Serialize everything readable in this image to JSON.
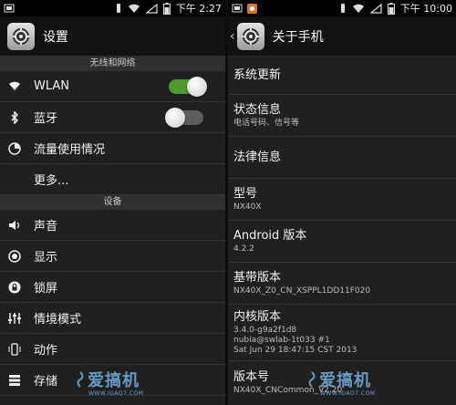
{
  "left": {
    "status_time": "下午 2:27",
    "title": "设置",
    "section_wireless": "无线和网络",
    "wlan_label": "WLAN",
    "wlan_on": true,
    "bluetooth_label": "蓝牙",
    "bluetooth_on": false,
    "data_usage_label": "流量使用情况",
    "more_label": "更多...",
    "section_device": "设备",
    "sound_label": "声音",
    "display_label": "显示",
    "lockscreen_label": "锁屏",
    "scenario_label": "情境模式",
    "motion_label": "动作",
    "storage_label": "存储"
  },
  "right": {
    "status_time": "下午 10:00",
    "title": "关于手机",
    "items": [
      {
        "title": "系统更新",
        "sub": []
      },
      {
        "title": "状态信息",
        "sub": [
          "电话号码、信号等"
        ]
      },
      {
        "title": "法律信息",
        "sub": []
      },
      {
        "title": "型号",
        "sub": [
          "NX40X"
        ]
      },
      {
        "title": "Android 版本",
        "sub": [
          "4.2.2"
        ]
      },
      {
        "title": "基带版本",
        "sub": [
          "NX40X_Z0_CN_XSPPL1DD11F020"
        ]
      },
      {
        "title": "内核版本",
        "sub": [
          "3.4.0-g9a2f1d8",
          "nubia@swlab-1t033 #1",
          "Sat Jun 29 18:47:15 CST 2013"
        ]
      },
      {
        "title": "版本号",
        "sub": [
          "NX40X_CNCommon_V2.20"
        ]
      }
    ]
  },
  "watermark": {
    "text": "爱搞机",
    "url": "WWW.IGAO7.COM"
  },
  "colors": {
    "toggle_on": "#4f9a2d",
    "watermark": "#6fa7d6"
  },
  "icons": [
    "signal-icon",
    "wifi-icon",
    "battery-icon",
    "settings-gear-icon",
    "bluetooth-icon",
    "data-usage-icon",
    "volume-icon",
    "brightness-icon",
    "lock-icon",
    "sliders-icon",
    "motion-icon",
    "storage-icon",
    "notification-icon"
  ]
}
